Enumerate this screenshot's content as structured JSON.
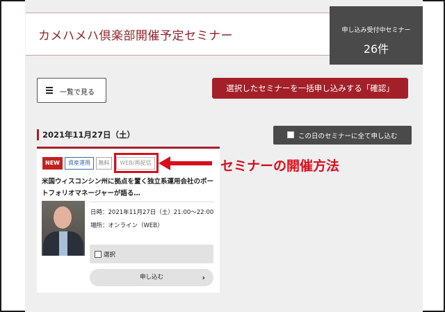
{
  "header": {
    "title": "カメハメハ倶楽部開催予定セミナー"
  },
  "count_box": {
    "label": "申し込み受付中セミナー",
    "value": "26件"
  },
  "list_button": {
    "label": "一覧で見る"
  },
  "bulk_button": {
    "label": "選択したセミナーを一括申し込みする「確認」"
  },
  "date_section": {
    "date": "2021年11月27日（土）",
    "apply_all_label": "この日のセミナーに全て申し込む"
  },
  "card": {
    "tags": [
      "NEW",
      "資産運用",
      "無料",
      "WEB/再配信"
    ],
    "title": "米国ウィスコンシン州に拠点を置く独立系運用会社のポートフォリオマネージャーが語る…",
    "datetime": "日時：2021年11月27日（土）21:00～22:00",
    "place": "場所：オンライン（WEB）",
    "select_label": "選択",
    "apply_label": "申し込む",
    "apply_chevron": "›"
  },
  "annotation": {
    "text": "セミナーの開催方法"
  },
  "colors": {
    "brand": "#a42028",
    "annotation": "#d80e1c",
    "dark_box": "#4a4a4a"
  }
}
